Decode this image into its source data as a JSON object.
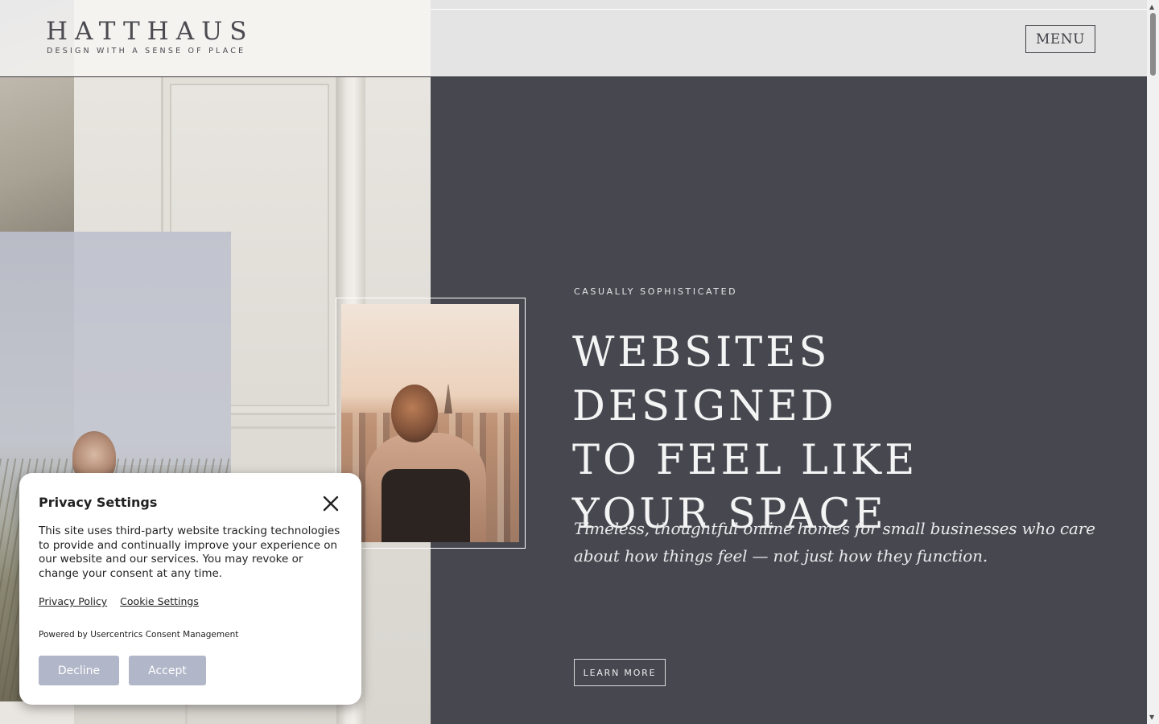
{
  "header": {
    "logo": "HATTHAUS",
    "tagline": "DESIGN WITH A SENSE OF PLACE",
    "menu_label": "MENU"
  },
  "hero": {
    "eyebrow": "CASUALLY SOPHISTICATED",
    "headline_lines": [
      "WEBSITES DESIGNED",
      "TO FEEL LIKE",
      "YOUR SPACE"
    ],
    "subhead": "Timeless, thoughtful online homes for small businesses who care about how things feel — not just how they function.",
    "cta_label": "LEARN MORE"
  },
  "privacy": {
    "title": "Privacy Settings",
    "close_icon": "close-icon",
    "body": "This site uses third-party website tracking technologies to provide and continually improve your experience on our website and our services. You may revoke or change your consent at any time.",
    "links": [
      "Privacy Policy",
      "Cookie Settings"
    ],
    "powered_by": "Powered by Usercentrics Consent Management",
    "decline_label": "Decline",
    "accept_label": "Accept"
  },
  "colors": {
    "hero_background": "#47484f",
    "header_background": "#e4e4e4",
    "consent_button": "#b1b6c8"
  }
}
